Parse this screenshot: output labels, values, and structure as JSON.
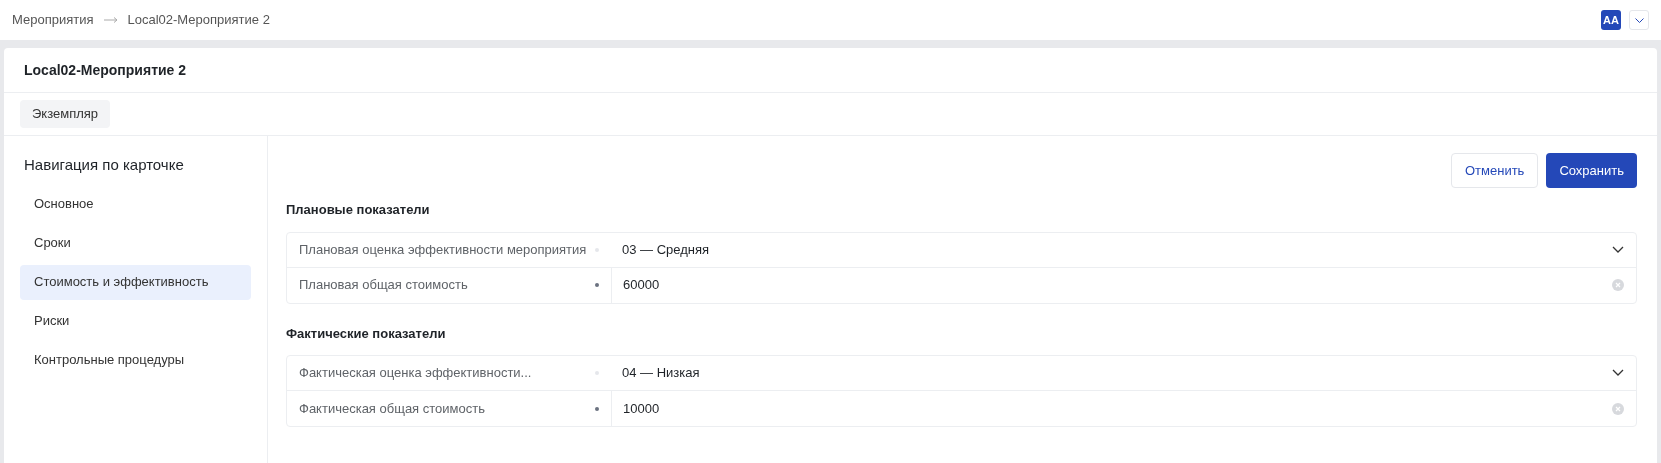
{
  "breadcrumbs": [
    "Мероприятия",
    "Local02-Мероприятие 2"
  ],
  "user": {
    "initials": "AA"
  },
  "card": {
    "title": "Local02-Мероприятие 2",
    "tabs": [
      {
        "label": "Экземпляр",
        "selected": true
      }
    ],
    "navigation": {
      "title": "Навигация по карточке",
      "items": [
        {
          "label": "Основное",
          "selected": false
        },
        {
          "label": "Сроки",
          "selected": false
        },
        {
          "label": "Стоимость и эффективность",
          "selected": true
        },
        {
          "label": "Риски",
          "selected": false
        },
        {
          "label": "Контрольные процедуры",
          "selected": false
        }
      ]
    },
    "actions": {
      "cancel": "Отменить",
      "save": "Сохранить"
    },
    "sections": [
      {
        "title": "Плановые показатели",
        "fields": [
          {
            "kind": "select",
            "label": "Плановая оценка эффективности мероприятия",
            "value": "03 — Средняя"
          },
          {
            "kind": "input",
            "label": "Плановая общая стоимость",
            "value": "60000"
          }
        ]
      },
      {
        "title": "Фактические показатели",
        "fields": [
          {
            "kind": "select",
            "label": "Фактическая оценка эффективности...",
            "value": "04 — Низкая"
          },
          {
            "kind": "input",
            "label": "Фактическая общая стоимость",
            "value": "10000"
          }
        ]
      }
    ]
  }
}
